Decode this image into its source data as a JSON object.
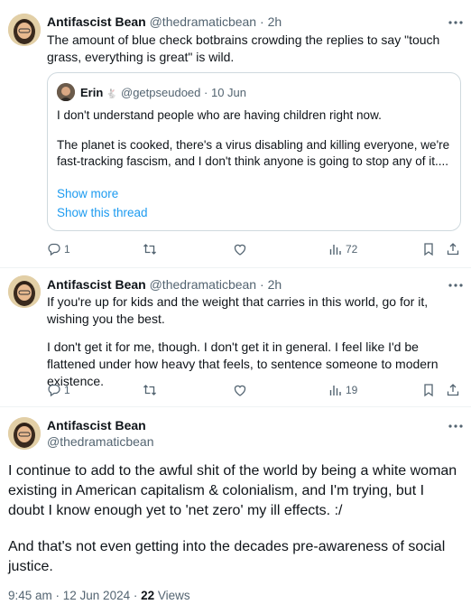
{
  "tweet1": {
    "name": "Antifascist Bean",
    "handle": "@thedramaticbean",
    "sep": "·",
    "time": "2h",
    "text": "The amount of blue check botbrains crowding the replies to say \"touch grass, everything is great\" is wild.",
    "quote": {
      "name": "Erin",
      "name_emoji": "🐇",
      "handle": "@getpseudoed",
      "sep": "·",
      "date": "10 Jun",
      "line1": "I don't understand people who are having children right now.",
      "line2": "The planet is cooked, there's a virus disabling and killing everyone, we're fast-tracking fascism, and I don't think anyone is going to stop any of it....",
      "show_more": "Show more",
      "show_thread": "Show this thread"
    },
    "actions": {
      "replies": "1",
      "views": "72"
    }
  },
  "tweet2": {
    "name": "Antifascist Bean",
    "handle": "@thedramaticbean",
    "sep": "·",
    "time": "2h",
    "para1": "If you're up for kids and the weight that carries in this world, go for it, wishing you the best.",
    "para2": "I don't get it for me, though. I don't get it in general. I feel like I'd be flattened under how heavy that feels, to sentence someone to modern existence.",
    "actions": {
      "replies": "1",
      "views": "19"
    }
  },
  "main_tweet": {
    "name": "Antifascist Bean",
    "handle": "@thedramaticbean",
    "para1": "I continue to add to the awful shit of the world by being a white woman existing in American capitalism & colonialism, and I'm trying, but I doubt I know enough yet to 'net zero' my ill effects. :/",
    "para2": "And that's not even getting into the decades pre-awareness of social justice.",
    "timestamp": "9:45 am · 12 Jun 2024 · ",
    "views_count": "22",
    "views_label": " Views"
  },
  "icons": {
    "reply": "reply-icon",
    "retweet": "retweet-icon",
    "like": "heart-icon",
    "views": "views-icon",
    "bookmark": "bookmark-icon",
    "share": "share-icon",
    "more": "more-icon"
  },
  "colors": {
    "link": "#1d9bf0",
    "muted": "#536471",
    "text": "#0f1419",
    "border": "#cfd9de"
  }
}
